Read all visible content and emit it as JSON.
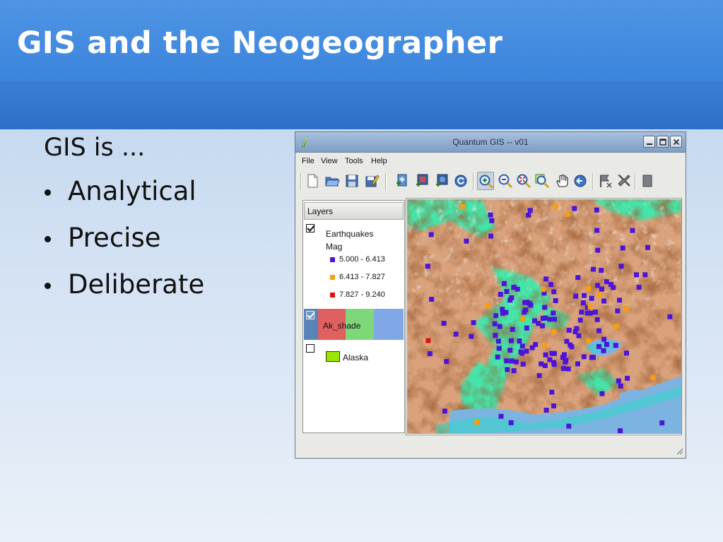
{
  "slide": {
    "title": "GIS and the Neogeographer",
    "lead": "GIS is ...",
    "bullets": [
      "Analytical",
      "Precise",
      "Deliberate"
    ]
  },
  "window": {
    "title": "Quantum GIS -- v01",
    "menu": [
      "File",
      "View",
      "Tools",
      "Help"
    ],
    "toolbar_icons": [
      "new-project-icon",
      "open-project-icon",
      "save-project-icon",
      "save-as-icon",
      "add-vector-layer-icon",
      "add-raster-layer-icon",
      "add-postgis-layer-icon",
      "refresh-icon",
      "zoom-in-icon",
      "zoom-out-icon",
      "zoom-full-icon",
      "zoom-to-layer-icon",
      "pan-icon",
      "zoom-previous-icon",
      "identify-icon",
      "select-icon",
      "measure-icon"
    ],
    "title_controls": [
      "minimize-icon",
      "maximize-icon",
      "close-icon"
    ]
  },
  "layers_panel": {
    "header": "Layers",
    "layers": [
      {
        "name": "Earthquakes",
        "field": "Mag",
        "checked": true,
        "classes": [
          {
            "label": "5.000 - 6.413",
            "color": "#4b14d8"
          },
          {
            "label": "6.413 - 7.827",
            "color": "#f5a00c"
          },
          {
            "label": "7.827 - 9.240",
            "color": "#e0120e"
          }
        ]
      },
      {
        "name": "Ak_shade",
        "checked": true,
        "selected": true,
        "colors": [
          "#e06060",
          "#7ed87a",
          "#80a8e6"
        ]
      },
      {
        "name": "Alaska",
        "checked": false,
        "fill": "#99e600"
      }
    ]
  },
  "colors": {
    "header_blue": "#3b84dc",
    "quake_low": "#4b14d8",
    "quake_mid": "#f5a00c",
    "quake_high": "#e0120e",
    "map_land": "#d9a27c",
    "map_lowland": "#45e4a8",
    "map_water": "#7db3e0"
  }
}
